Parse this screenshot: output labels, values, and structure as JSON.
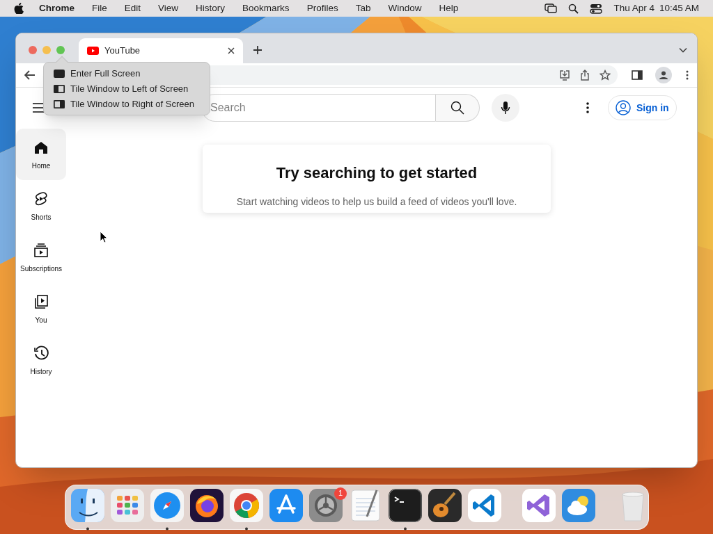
{
  "menu_bar": {
    "app": "Chrome",
    "items": [
      "File",
      "Edit",
      "View",
      "History",
      "Bookmarks",
      "Profiles",
      "Tab",
      "Window",
      "Help"
    ],
    "date": "Thu Apr 4",
    "time": "10:45 AM"
  },
  "browser": {
    "tabs": [
      {
        "title": "YouTube",
        "selected": true
      }
    ],
    "window_menu": [
      {
        "kind": "full",
        "label": "Enter Full Screen"
      },
      {
        "kind": "left",
        "label": "Tile Window to Left of Screen"
      },
      {
        "kind": "right",
        "label": "Tile Window to Right of Screen"
      }
    ]
  },
  "youtube": {
    "search": {
      "placeholder": "Search"
    },
    "sign_in": "Sign in",
    "sidebar": [
      {
        "kind": "home",
        "label": "Home",
        "selected": true
      },
      {
        "kind": "shorts",
        "label": "Shorts",
        "selected": false
      },
      {
        "kind": "subscriptions",
        "label": "Subscriptions",
        "selected": false
      },
      {
        "kind": "you",
        "label": "You",
        "selected": false
      },
      {
        "kind": "history",
        "label": "History",
        "selected": false
      }
    ],
    "empty_state": {
      "title": "Try searching to get started",
      "message": "Start watching videos to help us build a feed of videos you'll love."
    }
  },
  "dock": [
    {
      "kind": "finder",
      "running": true
    },
    {
      "kind": "launchpad",
      "running": false
    },
    {
      "kind": "safari",
      "running": true
    },
    {
      "kind": "firefox",
      "running": false
    },
    {
      "kind": "chrome",
      "running": true
    },
    {
      "kind": "appstore",
      "running": false
    },
    {
      "kind": "settings",
      "running": false,
      "badge": "1"
    },
    {
      "kind": "textedit",
      "running": false
    },
    {
      "kind": "terminal",
      "running": true
    },
    {
      "kind": "guitar",
      "running": false
    },
    {
      "kind": "vscode",
      "running": false
    },
    {
      "kind": "separator"
    },
    {
      "kind": "vstudio",
      "running": false
    },
    {
      "kind": "weather",
      "running": false
    },
    {
      "kind": "separator"
    },
    {
      "kind": "trash",
      "running": false
    }
  ]
}
